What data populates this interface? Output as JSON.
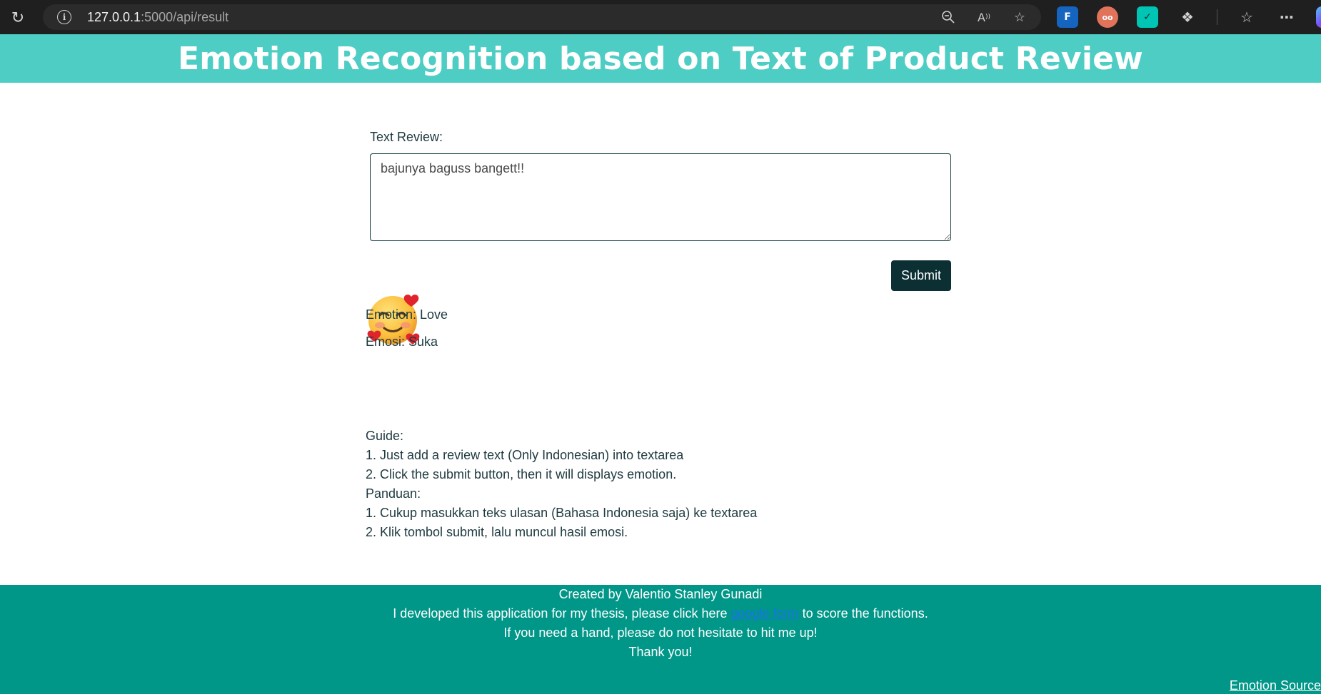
{
  "browser": {
    "url_host": "127.0.0.1",
    "url_path": ":5000/api/result",
    "icons": [
      "reload-icon",
      "info-icon",
      "zoom-out-icon",
      "read-aloud-icon",
      "favorite-star-icon",
      "extension-icon",
      "extension-icon",
      "extension-icon",
      "extensions-puzzle-icon",
      "favorites-icon",
      "more-icon",
      "copilot-icon"
    ]
  },
  "header": {
    "title": "Emotion Recognition based on Text of Product Review"
  },
  "form": {
    "label": "Text Review:",
    "textarea_value": "bajunya baguss bangett!!",
    "submit_label": "Submit"
  },
  "result": {
    "emoji_name": "smiling-face-with-hearts-icon",
    "emotion_line": "Emotion: Love",
    "emosi_line": "Emosi: Suka"
  },
  "guide": {
    "lines": [
      "Guide:",
      "1. Just add a review text (Only Indonesian) into textarea",
      "2. Click the submit button, then it will displays emotion.",
      "Panduan:",
      "1. Cukup masukkan teks ulasan (Bahasa Indonesia saja) ke textarea",
      "2. Klik tombol submit, lalu muncul hasil emosi."
    ]
  },
  "footer": {
    "created_by": "Created by Valentio Stanley Gunadi",
    "thesis_prefix": "I developed this application for my thesis, please click here ",
    "form_link": "google form",
    "thesis_suffix": " to score the functions.",
    "help_line": "If you need a hand, please do not hesitate to hit me up!",
    "thanks_line": "Thank you!",
    "source_link": "Emotion Source"
  },
  "colors": {
    "header_bg": "#4ecdc4",
    "footer_bg": "#009688",
    "button_bg": "#0b2f33",
    "link": "#1a73e8"
  }
}
